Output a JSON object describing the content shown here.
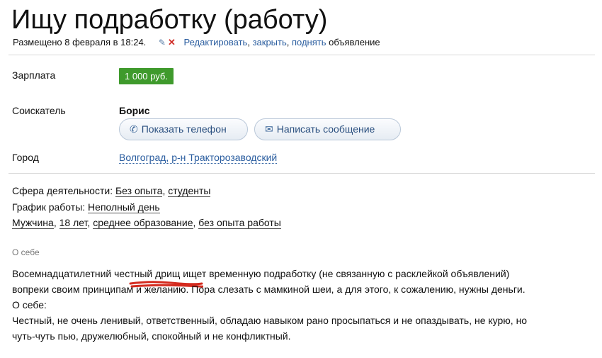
{
  "title": "Ищу подработку (работу)",
  "meta": {
    "posted": "Размещено 8 февраля в 18:24.",
    "edit": "Редактировать",
    "close": "закрыть",
    "raise": "поднять",
    "tail": "объявление"
  },
  "fields": {
    "salary_label": "Зарплата",
    "salary_value": "1 000 руб.",
    "applicant_label": "Соискатель",
    "applicant_name": "Борис",
    "show_phone": "Показать телефон",
    "write_message": "Написать сообщение",
    "city_label": "Город",
    "city_value": "Волгоград, р-н Тракторозаводский"
  },
  "details": {
    "sphere_label": "Сфера деятельности:",
    "sphere_1": "Без опыта",
    "sphere_2": "студенты",
    "schedule_label": "График работы:",
    "schedule_value": "Неполный день",
    "gender": "Мужчина",
    "age": "18 лет",
    "education": "среднее образование",
    "experience": "без опыта работы"
  },
  "about": {
    "heading": "О себе",
    "p1_a": "Восемнадцатилетний ",
    "p1_b": "честный дрищ",
    "p1_c": " ищет временную подработку (не связанную с расклейкой объявлений)",
    "p2": "вопреки своим принципам и желанию. Пора слезать с мамкиной шеи, а для этого, к сожалению, нужны деньги.",
    "p3": "О себе:",
    "p4": "Честный, не очень ленивый, ответственный, обладаю навыком рано просыпаться и не опаздывать, не курю, но",
    "p5": "чуть-чуть пью, дружелюбный, спокойный и не конфликтный."
  },
  "colors": {
    "link": "#2a5d9f",
    "salary_badge": "#3f9a2c",
    "delete_x": "#d0302a",
    "annotation": "#d42a1e"
  },
  "icons": [
    "pencil-icon",
    "delete-x-icon",
    "phone-icon",
    "envelope-icon"
  ]
}
